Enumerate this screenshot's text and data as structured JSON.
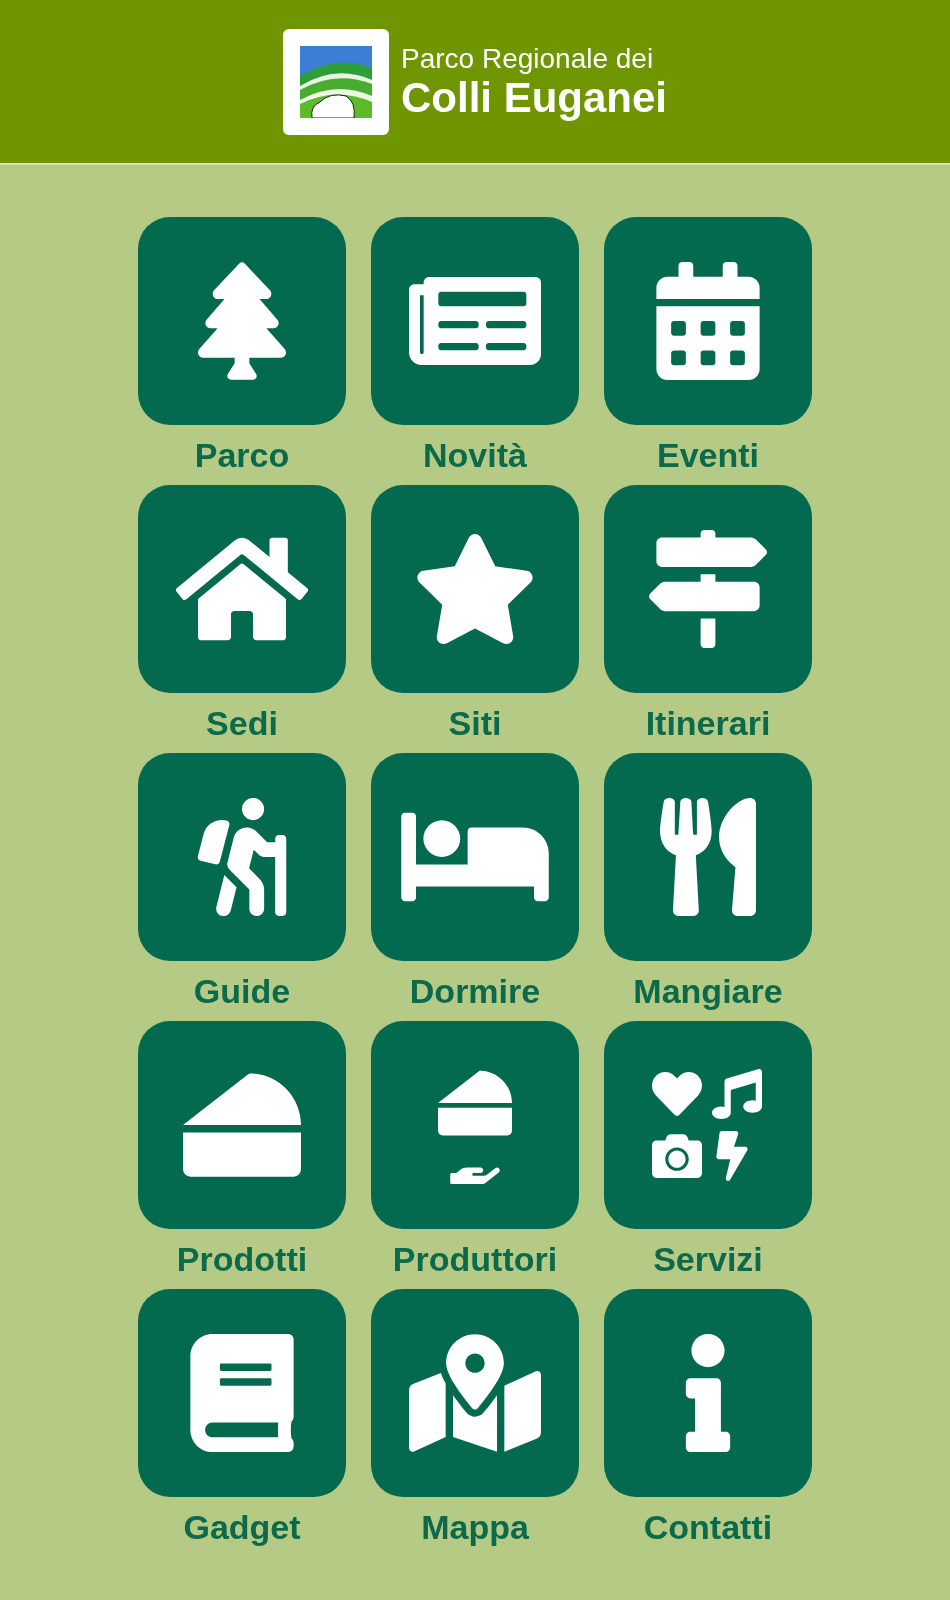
{
  "header": {
    "logo_line_1": "Parco Regionale dei",
    "logo_line_2": "Colli Euganei"
  },
  "menu": [
    {
      "kind": "tree",
      "label": "Parco"
    },
    {
      "kind": "newspaper",
      "label": "Novità"
    },
    {
      "kind": "calendar",
      "label": "Eventi"
    },
    {
      "kind": "house",
      "label": "Sedi"
    },
    {
      "kind": "star",
      "label": "Siti"
    },
    {
      "kind": "signpost",
      "label": "Itinerari"
    },
    {
      "kind": "hiker",
      "label": "Guide"
    },
    {
      "kind": "bed",
      "label": "Dormire"
    },
    {
      "kind": "cutlery",
      "label": "Mangiare"
    },
    {
      "kind": "cheese",
      "label": "Prodotti"
    },
    {
      "kind": "cheese-hand",
      "label": "Produttori"
    },
    {
      "kind": "services",
      "label": "Servizi"
    },
    {
      "kind": "book",
      "label": "Gadget"
    },
    {
      "kind": "map",
      "label": "Mappa"
    },
    {
      "kind": "info",
      "label": "Contatti"
    }
  ]
}
